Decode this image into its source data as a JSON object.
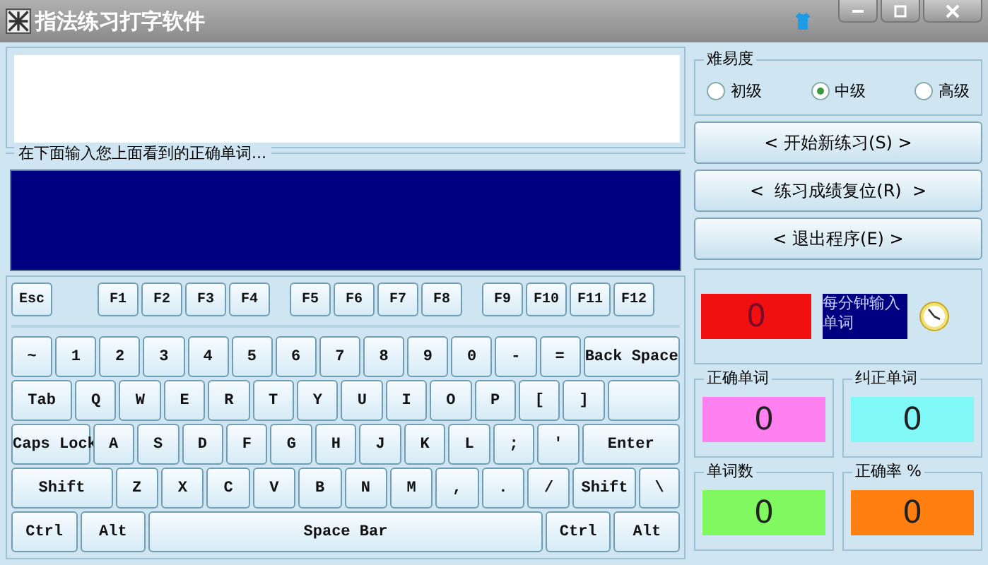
{
  "window": {
    "title": "指法练习打字软件"
  },
  "input_group": {
    "label": "在下面输入您上面看到的正确单词..."
  },
  "difficulty": {
    "label": "难易度",
    "options": [
      {
        "label": "初级",
        "selected": false
      },
      {
        "label": "中级",
        "selected": true
      },
      {
        "label": "高级",
        "selected": false
      }
    ]
  },
  "buttons": [
    "< 开始新练习(S) >",
    "<  练习成绩复位(R)  >",
    "< 退出程序(E) >"
  ],
  "speed": {
    "value": "0",
    "color": "#f01010",
    "label": "每分钟输入单词"
  },
  "stats": [
    {
      "label": "正确单词",
      "value": "0",
      "color": "#ff80f0"
    },
    {
      "label": "纠正单词",
      "value": "0",
      "color": "#80f8f8"
    },
    {
      "label": "单词数",
      "value": "0",
      "color": "#80f860"
    },
    {
      "label": "正确率 %",
      "value": "0",
      "color": "#ff8010"
    }
  ],
  "function_keys": [
    [
      "Esc"
    ],
    [
      "F1",
      "F2",
      "F3",
      "F4"
    ],
    [
      "F5",
      "F6",
      "F7",
      "F8"
    ],
    [
      "F9",
      "F10",
      "F11",
      "F12"
    ]
  ],
  "keyboard_rows": [
    [
      {
        "label": "~",
        "kind": "char"
      },
      {
        "label": "1",
        "kind": "char"
      },
      {
        "label": "2",
        "kind": "char"
      },
      {
        "label": "3",
        "kind": "char"
      },
      {
        "label": "4",
        "kind": "char"
      },
      {
        "label": "5",
        "kind": "char"
      },
      {
        "label": "6",
        "kind": "char"
      },
      {
        "label": "7",
        "kind": "char"
      },
      {
        "label": "8",
        "kind": "char"
      },
      {
        "label": "9",
        "kind": "char"
      },
      {
        "label": "0",
        "kind": "char"
      },
      {
        "label": "-",
        "kind": "char"
      },
      {
        "label": "=",
        "kind": "char"
      },
      {
        "label": "Back Space",
        "kind": "wide"
      }
    ],
    [
      {
        "label": "Tab",
        "kind": "mid"
      },
      {
        "label": "Q",
        "kind": "char"
      },
      {
        "label": "W",
        "kind": "char"
      },
      {
        "label": "E",
        "kind": "char"
      },
      {
        "label": "R",
        "kind": "char"
      },
      {
        "label": "T",
        "kind": "char"
      },
      {
        "label": "Y",
        "kind": "char"
      },
      {
        "label": "U",
        "kind": "char"
      },
      {
        "label": "I",
        "kind": "char"
      },
      {
        "label": "O",
        "kind": "char"
      },
      {
        "label": "P",
        "kind": "char"
      },
      {
        "label": "[",
        "kind": "char"
      },
      {
        "label": "]",
        "kind": "char"
      },
      {
        "kind": "blank"
      }
    ],
    [
      {
        "label": "Caps Lock",
        "kind": "caps"
      },
      {
        "label": "A",
        "kind": "char"
      },
      {
        "label": "S",
        "kind": "char"
      },
      {
        "label": "D",
        "kind": "char"
      },
      {
        "label": "F",
        "kind": "char"
      },
      {
        "label": "G",
        "kind": "char"
      },
      {
        "label": "H",
        "kind": "char"
      },
      {
        "label": "J",
        "kind": "char"
      },
      {
        "label": "K",
        "kind": "char"
      },
      {
        "label": "L",
        "kind": "char"
      },
      {
        "label": ";",
        "kind": "char"
      },
      {
        "label": "'",
        "kind": "char"
      },
      {
        "label": "Enter",
        "kind": "wide"
      }
    ],
    [
      {
        "label": "Shift",
        "kind": "wide"
      },
      {
        "label": "Z",
        "kind": "char"
      },
      {
        "label": "X",
        "kind": "char"
      },
      {
        "label": "C",
        "kind": "char"
      },
      {
        "label": "V",
        "kind": "char"
      },
      {
        "label": "B",
        "kind": "char"
      },
      {
        "label": "N",
        "kind": "char"
      },
      {
        "label": "M",
        "kind": "char"
      },
      {
        "label": ",",
        "kind": "char"
      },
      {
        "label": ".",
        "kind": "char"
      },
      {
        "label": "/",
        "kind": "char"
      },
      {
        "label": "Shift",
        "kind": "mid"
      },
      {
        "label": "\\",
        "kind": "narrow"
      }
    ],
    [
      {
        "label": "Ctrl",
        "kind": "mid"
      },
      {
        "label": "Alt",
        "kind": "mid"
      },
      {
        "label": "Space Bar",
        "kind": "space"
      },
      {
        "label": "Ctrl",
        "kind": "mid"
      },
      {
        "label": "Alt",
        "kind": "mid"
      }
    ]
  ]
}
